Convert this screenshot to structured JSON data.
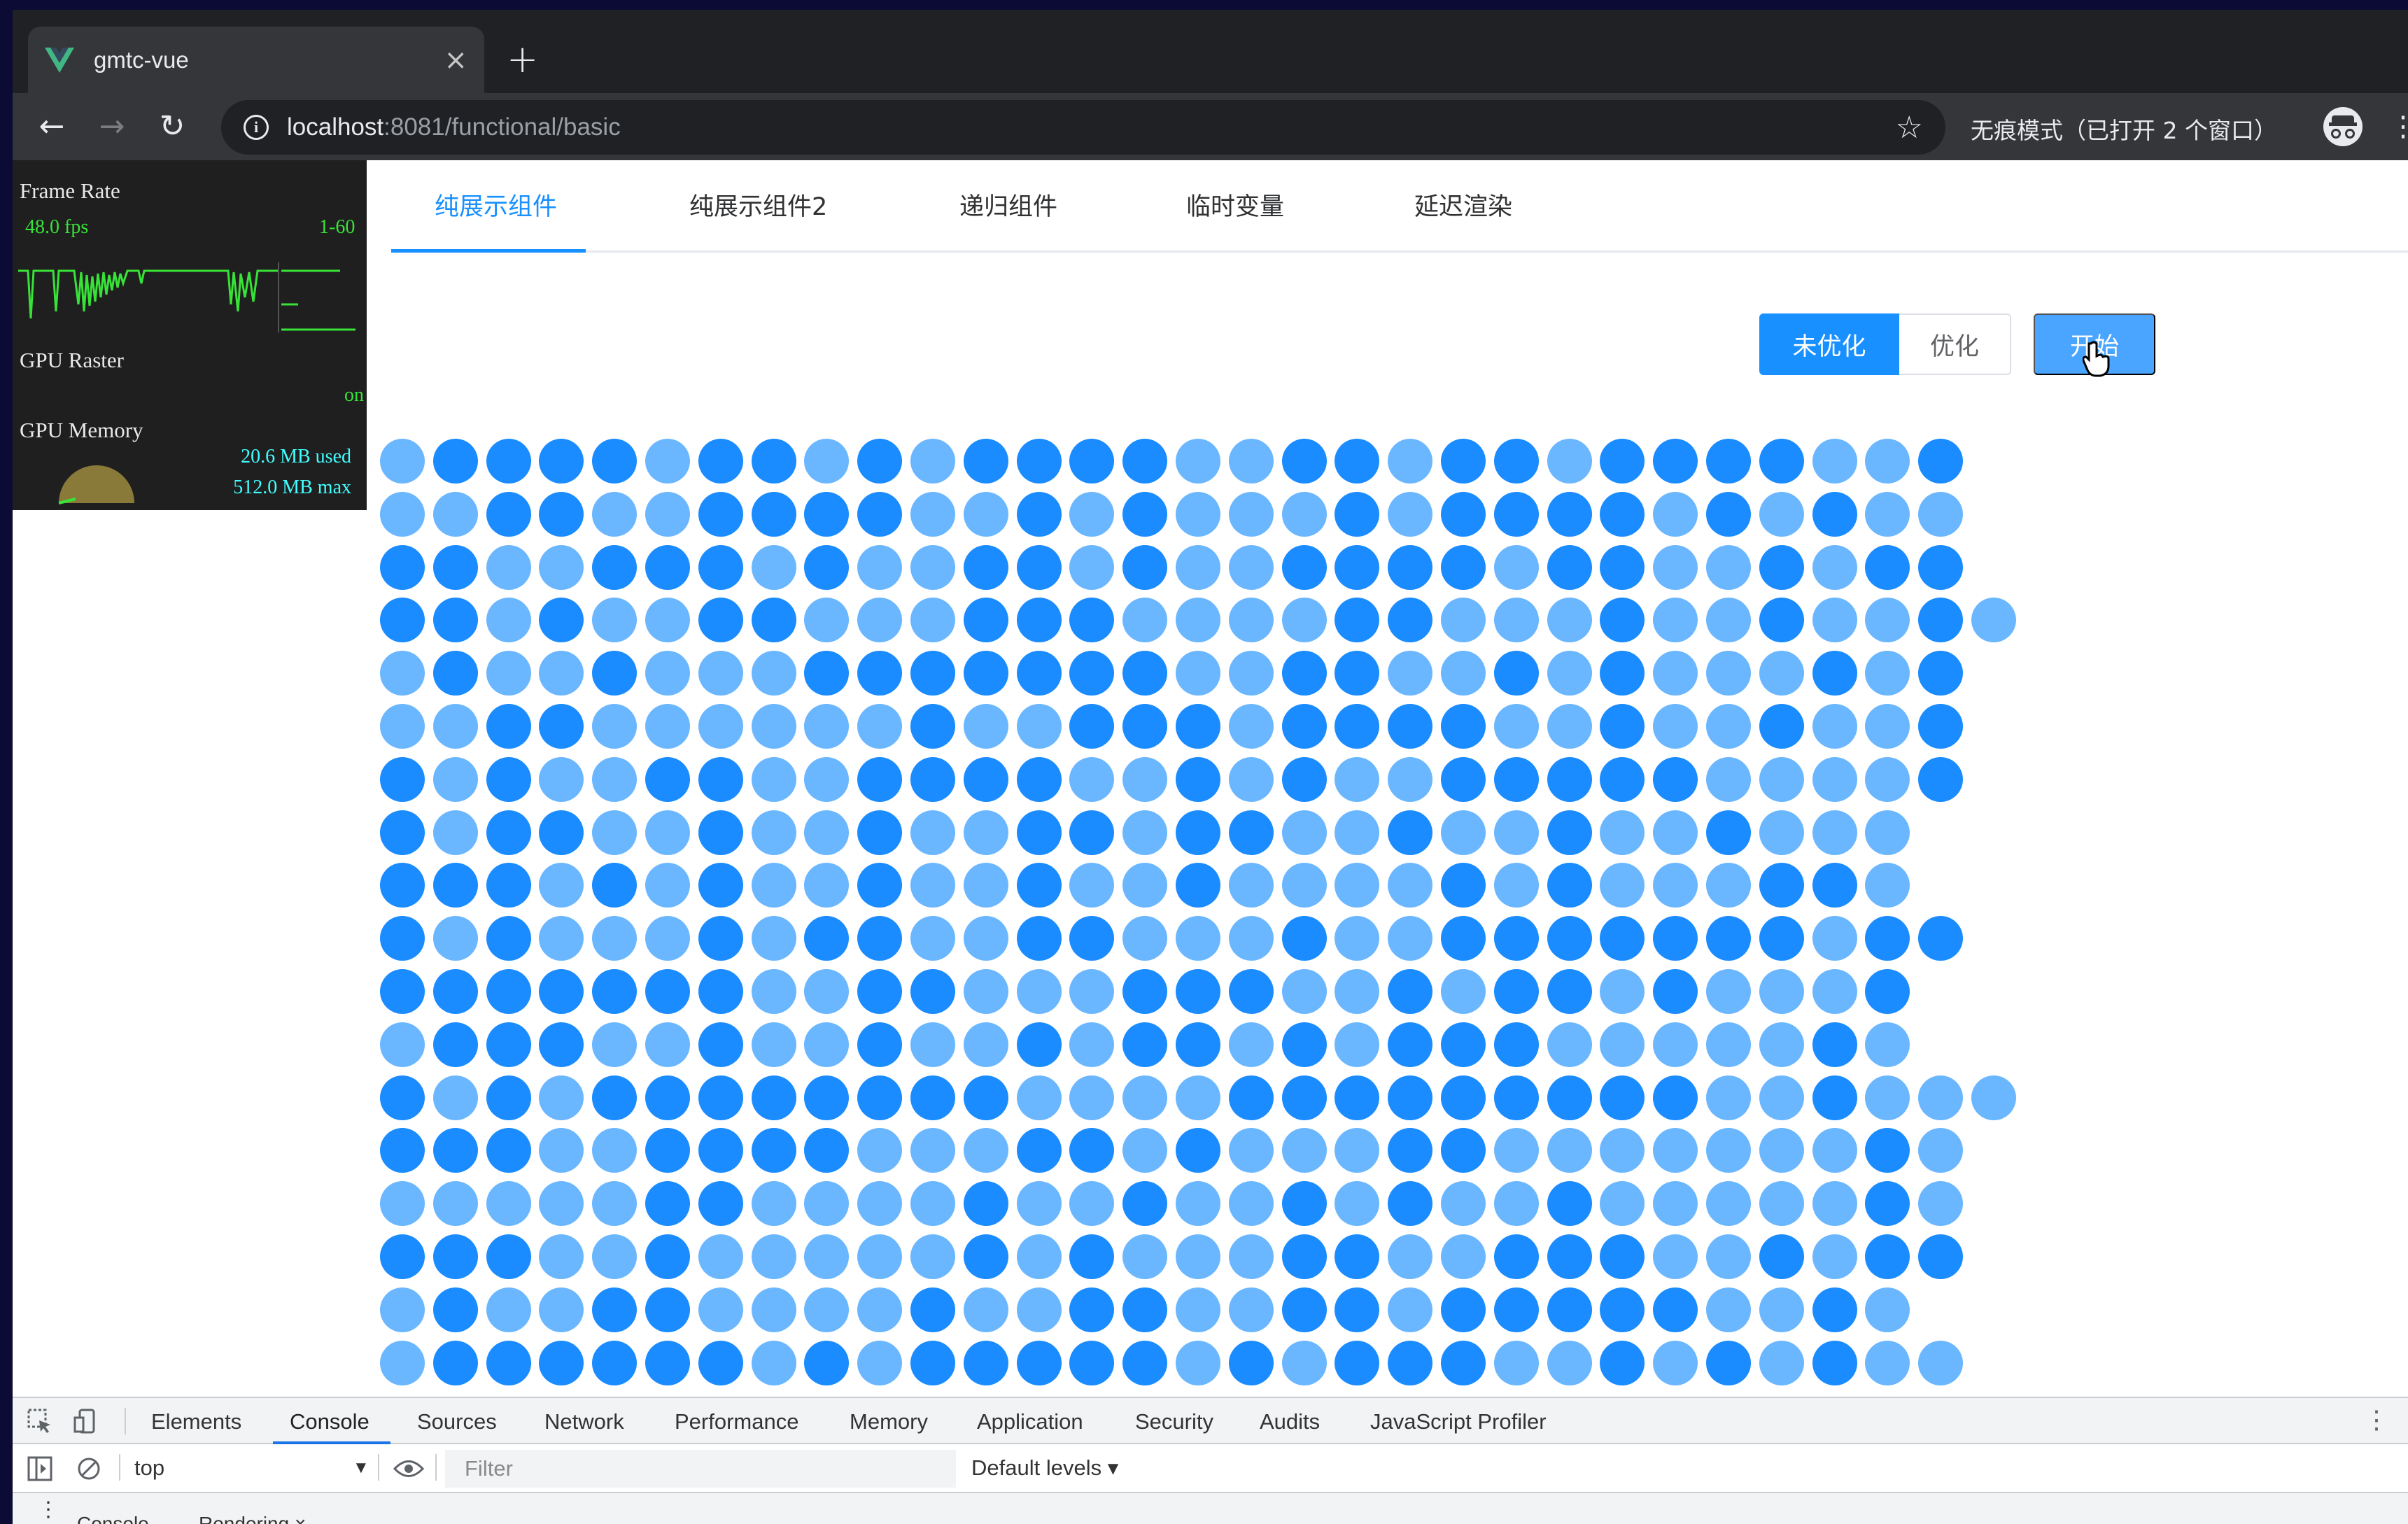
{
  "browser": {
    "tab_title": "gmtc-vue",
    "tab_close": "×",
    "new_tab": "+",
    "back": "←",
    "forward": "→",
    "reload": "↻",
    "info": "i",
    "url_host": "localhost",
    "url_rest": ":8081/functional/basic",
    "star": "☆",
    "incognito_label": "无痕模式（已打开 2 个窗口）",
    "menu": "⋮"
  },
  "fps_meter": {
    "frame_rate_label": "Frame Rate",
    "fps_value": "48.0 fps",
    "fps_range": "1-60",
    "gpu_raster_label": "GPU Raster",
    "gpu_raster_value": "on",
    "gpu_memory_label": "GPU Memory",
    "memory_used": "20.6 MB used",
    "memory_max": "512.0 MB max",
    "colors": {
      "bg": "#1f1f1f",
      "green": "#38e338",
      "cyan": "#42ffff"
    }
  },
  "page": {
    "tabs": [
      {
        "label": "纯展示组件",
        "active": true
      },
      {
        "label": "纯展示组件2",
        "active": false
      },
      {
        "label": "递归组件",
        "active": false
      },
      {
        "label": "临时变量",
        "active": false
      },
      {
        "label": "延迟渲染",
        "active": false
      }
    ],
    "toggle": {
      "unoptimized": "未优化",
      "optimized": "优化",
      "selected": "未优化"
    },
    "start_button": "开始",
    "colors": {
      "primary": "#1890ff",
      "dot_dark": "#1a8cff",
      "dot_light": "#6bb7ff"
    },
    "dots": [
      "lddddlddldlddddllddlddlddddlld",
      "llddllddddlldldllldlddddldldll",
      "ddlldddldllddldllddddlddlldldd",
      "ddldllddllldddllllddllldlldlldl",
      "ldlldllldddddddllddlldldllldld",
      "llddlllllldlldddlddddlldlldlld",
      "dldllddllddddlldldlldddddlllld",
      "dlddlldlldllddlddlldlldlldlll",
      "dddldldlldlldlldlllldldlllddl",
      "dldllldlddllddllldlldddddddldd",
      "dddddddllddllldddlldlddldllld",
      "ldddlldlldlldlddldldddllllldl",
      "dldlddddddddlllldddddddddlldlll",
      "dddllddddlllddldlllddllllllldl",
      "lllllddlllldlldlldldlldllllldl",
      "dddlldllllldldlllddlldddlldldd",
      "ldllddlllldllddllddldddddlldl",
      "lddddddldldddddldldddlldldldll"
    ]
  },
  "devtools": {
    "tabs": [
      "Elements",
      "Console",
      "Sources",
      "Network",
      "Performance",
      "Memory",
      "Application",
      "Security",
      "Audits",
      "JavaScript Profiler"
    ],
    "active_tab": "Console",
    "context": "top",
    "filter_placeholder": "Filter",
    "levels": "Default levels ▾",
    "drawer_tabs": [
      "Console",
      "Rendering ×"
    ]
  }
}
